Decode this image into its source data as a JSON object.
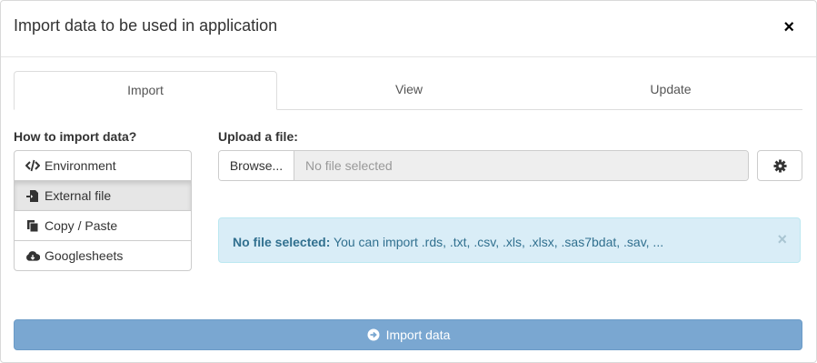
{
  "modal": {
    "title": "Import data to be used in application",
    "close_label": "×"
  },
  "tabs": [
    {
      "label": "Import",
      "active": true
    },
    {
      "label": "View",
      "active": false
    },
    {
      "label": "Update",
      "active": false
    }
  ],
  "sidebar": {
    "heading": "How to import data?",
    "items": [
      {
        "label": "Environment",
        "icon": "code-icon",
        "active": false
      },
      {
        "label": "External file",
        "icon": "file-import-icon",
        "active": true
      },
      {
        "label": "Copy / Paste",
        "icon": "copy-icon",
        "active": false
      },
      {
        "label": "Googlesheets",
        "icon": "cloud-download-icon",
        "active": false
      }
    ]
  },
  "upload": {
    "heading": "Upload a file:",
    "browse_label": "Browse...",
    "file_text": "No file selected",
    "settings_icon": "gear-icon"
  },
  "alert": {
    "bold_text": "No file selected:",
    "message": " You can import .rds, .txt, .csv, .xls, .xlsx, .sas7bdat, .sav, ...",
    "close_label": "×"
  },
  "footer": {
    "import_label": "Import data",
    "icon": "arrow-circle-right-icon"
  },
  "colors": {
    "alert_bg": "#d9edf7",
    "alert_text": "#31708f",
    "import_button_bg": "#7aa7d1"
  }
}
